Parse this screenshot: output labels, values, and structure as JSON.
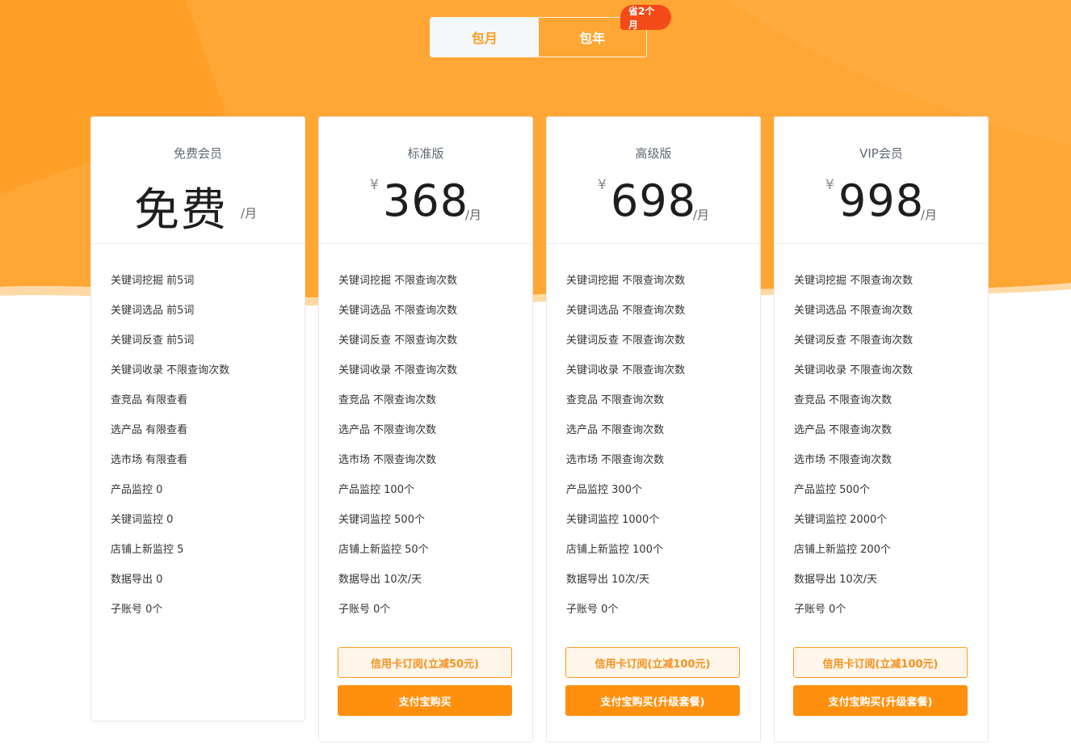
{
  "colors": {
    "accent": "#ff900e",
    "background_top": "#ffa634",
    "badge": "#f34a17",
    "credit_bg": "#fff6ea"
  },
  "toggle": {
    "monthly_label": "包月",
    "yearly_label": "包年",
    "badge_text": "省2个月",
    "selected": "monthly"
  },
  "plans": [
    {
      "name": "免费会员",
      "price_text": "免费",
      "unit": "/月",
      "features": [
        [
          "关键词挖掘",
          "前5词"
        ],
        [
          "关键词选品",
          "前5词"
        ],
        [
          "关键词反查",
          "前5词"
        ],
        [
          "关键词收录",
          "不限查询次数"
        ],
        [
          "查竞品",
          "有限查看"
        ],
        [
          "选产品",
          "有限查看"
        ],
        [
          "选市场",
          "有限查看"
        ],
        [
          "产品监控",
          "0"
        ],
        [
          "关键词监控",
          "0"
        ],
        [
          "店铺上新监控",
          "5"
        ],
        [
          "数据导出",
          "0"
        ],
        [
          "子账号",
          "0个"
        ]
      ]
    },
    {
      "name": "标准版",
      "currency": "¥",
      "price": "368",
      "unit": "/月",
      "features": [
        [
          "关键词挖掘",
          "不限查询次数"
        ],
        [
          "关键词选品",
          "不限查询次数"
        ],
        [
          "关键词反查",
          "不限查询次数"
        ],
        [
          "关键词收录",
          "不限查询次数"
        ],
        [
          "查竞品",
          "不限查询次数"
        ],
        [
          "选产品",
          "不限查询次数"
        ],
        [
          "选市场",
          "不限查询次数"
        ],
        [
          "产品监控",
          "100个"
        ],
        [
          "关键词监控",
          "500个"
        ],
        [
          "店铺上新监控",
          "50个"
        ],
        [
          "数据导出",
          "10次/天"
        ],
        [
          "子账号",
          "0个"
        ]
      ],
      "credit_button": "信用卡订阅(立减50元)",
      "alipay_button": "支付宝购买"
    },
    {
      "name": "高级版",
      "currency": "¥",
      "price": "698",
      "unit": "/月",
      "features": [
        [
          "关键词挖掘",
          "不限查询次数"
        ],
        [
          "关键词选品",
          "不限查询次数"
        ],
        [
          "关键词反查",
          "不限查询次数"
        ],
        [
          "关键词收录",
          "不限查询次数"
        ],
        [
          "查竞品",
          "不限查询次数"
        ],
        [
          "选产品",
          "不限查询次数"
        ],
        [
          "选市场",
          "不限查询次数"
        ],
        [
          "产品监控",
          "300个"
        ],
        [
          "关键词监控",
          "1000个"
        ],
        [
          "店铺上新监控",
          "100个"
        ],
        [
          "数据导出",
          "10次/天"
        ],
        [
          "子账号",
          "0个"
        ]
      ],
      "credit_button": "信用卡订阅(立减100元)",
      "alipay_button": "支付宝购买(升级套餐)"
    },
    {
      "name": "VIP会员",
      "currency": "¥",
      "price": "998",
      "unit": "/月",
      "features": [
        [
          "关键词挖掘",
          "不限查询次数"
        ],
        [
          "关键词选品",
          "不限查询次数"
        ],
        [
          "关键词反查",
          "不限查询次数"
        ],
        [
          "关键词收录",
          "不限查询次数"
        ],
        [
          "查竞品",
          "不限查询次数"
        ],
        [
          "选产品",
          "不限查询次数"
        ],
        [
          "选市场",
          "不限查询次数"
        ],
        [
          "产品监控",
          "500个"
        ],
        [
          "关键词监控",
          "2000个"
        ],
        [
          "店铺上新监控",
          "200个"
        ],
        [
          "数据导出",
          "10次/天"
        ],
        [
          "子账号",
          "0个"
        ]
      ],
      "credit_button": "信用卡订阅(立减100元)",
      "alipay_button": "支付宝购买(升级套餐)"
    }
  ]
}
